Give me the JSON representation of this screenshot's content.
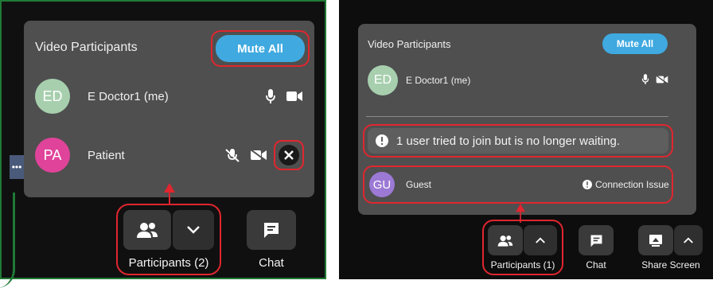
{
  "left": {
    "header": {
      "title": "Video Participants",
      "mute_all_label": "Mute All"
    },
    "participants": [
      {
        "initials": "ED",
        "name": "E Doctor1 (me)",
        "avatar_color": "#a7cfae"
      },
      {
        "initials": "PA",
        "name": "Patient",
        "avatar_color": "#e0439a"
      }
    ],
    "toolbar": {
      "participants_label": "Participants (2)",
      "chat_label": "Chat"
    }
  },
  "right": {
    "header": {
      "title": "Video Participants",
      "mute_all_label": "Mute All"
    },
    "participant": {
      "initials": "ED",
      "name": "E Doctor1 (me)",
      "avatar_color": "#a7cfae"
    },
    "notice_text": "1 user tried to join but is no longer waiting.",
    "guest": {
      "initials": "GU",
      "name": "Guest",
      "avatar_color": "#9b79d4",
      "status": "Connection Issue"
    },
    "toolbar": {
      "participants_label": "Participants (1)",
      "chat_label": "Chat",
      "share_label": "Share Screen"
    }
  },
  "colors": {
    "accent": "#3fa9e0",
    "highlight": "#e0262f",
    "panel": "#4f4f4f"
  },
  "icons": [
    "microphone-icon",
    "video-camera-icon",
    "mic-muted-icon",
    "video-off-icon",
    "close-icon",
    "people-icon",
    "chevron-down-icon",
    "chevron-up-icon",
    "chat-icon",
    "share-screen-icon",
    "info-icon",
    "arrow-up-icon"
  ]
}
